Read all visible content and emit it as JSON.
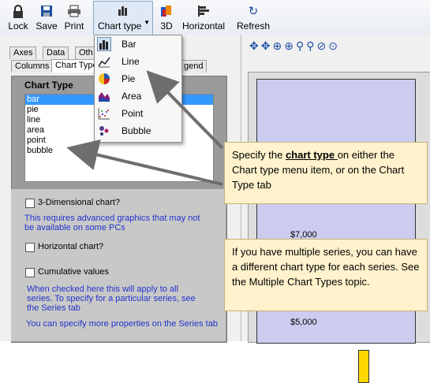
{
  "toolbar": {
    "lock": "Lock",
    "save": "Save",
    "print": "Print",
    "chart_type": "Chart type",
    "three_d": "3D",
    "horizontal": "Horizontal",
    "refresh": "Refresh"
  },
  "dropdown": {
    "items": [
      "Bar",
      "Line",
      "Pie",
      "Area",
      "Point",
      "Bubble"
    ]
  },
  "tabs": {
    "row1": [
      "Axes",
      "Data",
      "Oth"
    ],
    "row2": [
      "Columns",
      "Chart Type",
      "gend"
    ]
  },
  "panel": {
    "group_title": "Chart Type",
    "list": [
      "bar",
      "pie",
      "line",
      "area",
      "point",
      "bubble"
    ],
    "three_d_label": "3-Dimensional chart?",
    "three_d_note": "This requires advanced graphics that may not be available on some PCs",
    "horizontal_label": "Horizontal chart?",
    "cumulative_label": "Cumulative values",
    "cumulative_note": "When checked here this will apply to all series. To specify for a particular series, see the Series tab",
    "more_note": "You can specify more properties on the Series tab"
  },
  "chart": {
    "y_ticks": [
      "$7,000",
      "$5,000"
    ]
  },
  "callouts": {
    "first_pre": "Specify the ",
    "first_bold": "chart type ",
    "first_post": "on either the Chart type menu item, or on the Chart Type tab",
    "second": "If you have multiple series, you can have a different chart type for each series. See the Multiple Chart Types topic."
  },
  "colors": {
    "accent_blue": "#3399ff",
    "callout_fill": "#fff2cc",
    "bar_fill": "#ffd700",
    "plot_fill": "#ccccf0"
  }
}
